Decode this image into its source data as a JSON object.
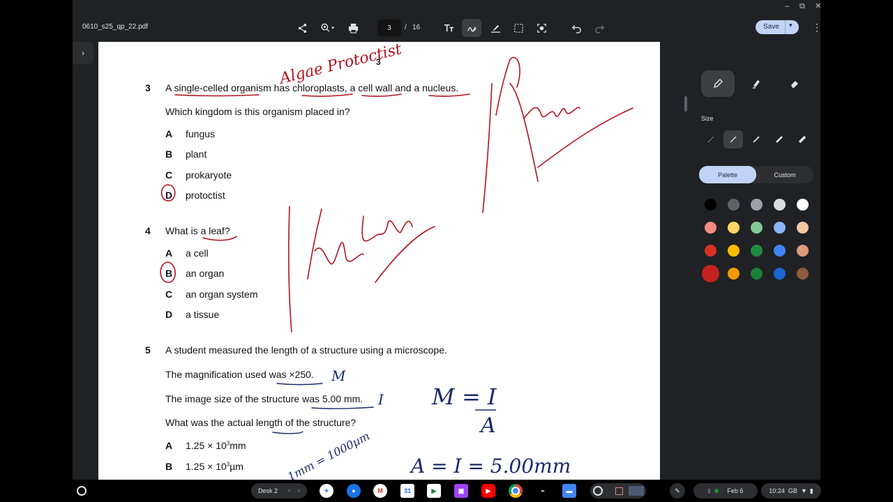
{
  "window": {
    "minimize": "–",
    "restore": "⧉",
    "close": "✕"
  },
  "toolbar": {
    "filename": "0610_s25_qp_22.pdf",
    "current_page": "3",
    "page_separator": "/",
    "total_pages": "16",
    "save_label": "Save",
    "icons": [
      "share-icon",
      "zoom-icon",
      "print-icon",
      "text-icon",
      "draw-icon",
      "highlighter-icon",
      "select-icon",
      "snapshot-icon",
      "undo-icon",
      "redo-icon"
    ]
  },
  "document": {
    "page_number": "3",
    "q3": {
      "number": "3",
      "stem": "A single-celled organism has chloroplasts, a cell wall and a nucleus.",
      "question": "Which kingdom is this organism placed in?",
      "options": [
        {
          "letter": "A",
          "text": "fungus"
        },
        {
          "letter": "B",
          "text": "plant"
        },
        {
          "letter": "C",
          "text": "prokaryote"
        },
        {
          "letter": "D",
          "text": "protoctist"
        }
      ]
    },
    "q4": {
      "number": "4",
      "question": "What is a leaf?",
      "options": [
        {
          "letter": "A",
          "text": "a cell"
        },
        {
          "letter": "B",
          "text": "an organ"
        },
        {
          "letter": "C",
          "text": "an organ system"
        },
        {
          "letter": "D",
          "text": "a tissue"
        }
      ]
    },
    "q5": {
      "number": "5",
      "stem": "A student measured the length of a structure using a microscope.",
      "line1": "The magnification used was ×250.",
      "line2": "The image size of the structure was 5.00 mm.",
      "question": "What was the actual length of the structure?",
      "options": [
        {
          "letter": "A",
          "text": "1.25 × 10",
          "sup": "3",
          "unit": "mm"
        },
        {
          "letter": "B",
          "text": "1.25 × 10",
          "sup": "3",
          "unit": "µm"
        }
      ]
    },
    "annotations": {
      "top_note": "Algae Protoctist",
      "name_right": "Rania",
      "name_left": "haider",
      "m_mark": "M",
      "i_mark": "I",
      "formula_top": "M = I",
      "formula_bottom": "A",
      "formula_lower": "A = I = 5.00mm",
      "conversion": "1mm = 1000µm"
    }
  },
  "pen_panel": {
    "tools": [
      "pen-icon",
      "highlighter-icon",
      "eraser-icon"
    ],
    "size_label": "Size",
    "tabs": {
      "palette": "Palette",
      "custom": "Custom"
    },
    "palette": [
      [
        "#000000",
        "#5f6368",
        "#9aa0a6",
        "#dadce0",
        "#ffffff"
      ],
      [
        "#f28b82",
        "#fdd663",
        "#81c995",
        "#8ab4f8",
        "#f6c7a3"
      ],
      [
        "#d93025",
        "#fbbc04",
        "#1e8e3e",
        "#4285f4",
        "#e09a7e"
      ],
      [
        "#c5221f",
        "#f29900",
        "#188038",
        "#1967d2",
        "#8d5a3b"
      ]
    ],
    "selected_color": "#c5221f"
  },
  "shelf": {
    "desk_label": "Desk 2",
    "date": "Feb 6",
    "time": "10:24",
    "ime": "GB"
  }
}
